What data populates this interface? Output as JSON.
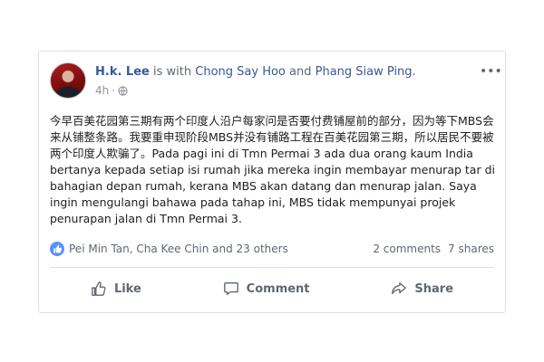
{
  "post": {
    "author": "H.k. Lee",
    "connector": "is with",
    "tagged_1": "Chong Say Hoo",
    "and": "and",
    "tagged_2": "Phang Siaw Ping.",
    "time": "4h",
    "privacy_icon": "globe-icon",
    "more_icon": "ellipsis-icon",
    "text": "今早百美花园第三期有两个印度人沿户每家问是否要付费铺屋前的部分，因为等下MBS会来从铺整条路。我要重申现阶段MBS并没有铺路工程在百美花园第三期，所以居民不要被两个印度人欺骗了。Pada pagi ini di Tmn Permai 3 ada dua orang kaum India bertanya kepada setiap isi rumah jika mereka ingin membayar menurap tar di bahagian depan rumah, kerana MBS akan datang dan menurap jalan. Saya ingin mengulangi bahawa pada tahap ini, MBS tidak mempunyai projek penurapan jalan di Tmn Permai 3."
  },
  "reactions": {
    "icon": "like-reaction-icon",
    "summary": "Pei Min Tan, Cha Kee Chin and 23 others",
    "comments": "2 comments",
    "shares": "7 shares"
  },
  "actions": {
    "like": "Like",
    "comment": "Comment",
    "share": "Share"
  },
  "colors": {
    "link": "#385898",
    "muted": "#606770",
    "like_badge": "#5890ff"
  }
}
